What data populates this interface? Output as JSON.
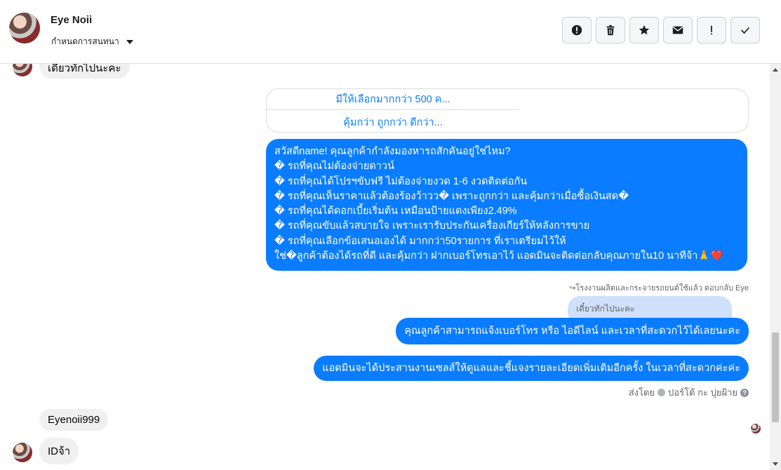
{
  "header": {
    "name": "Eye Noii",
    "assign_label": "กำหนดการสนทนา",
    "actions": [
      "mark-spam",
      "delete",
      "star",
      "mark-unread",
      "follow-up",
      "done"
    ]
  },
  "thread": {
    "prev_msg": "เดี๋ยวทักไปนะคะ",
    "quick_replies": [
      "มีให้เลือกมากกว่า 500 ค...",
      "คุ้มกว่า ถูกกว่า ดีกว่า..."
    ],
    "big_message_lines": [
      "สวัสดีname! คุณลูกค้ากำลังมองหารถสักคันอยู่ใช่ไหม?",
      "� รถที่คุณไม่ต้องจ่ายดาวน์",
      "� รถที่คุณได้โปรฯขับฟรี ไม่ต้องจ่ายงวด 1-6 งวดติดต่อกัน",
      "� รถที่คุณเห็นราคาแล้วต้องร้องว้าวว� เพราะถูกกว่า และคุ้มกว่าเมื่อซื้อเงินสด�",
      "� รถที่คุณได้ดอกเบี้ยเริ่มต้น เหมือนป้ายแดงเพียง2.49%",
      "� รถที่คุณขับแล้วสบายใจ เพราะเรารับประกันเครื่องเกียร์ให้หลังการขาย",
      "� รถที่คุณเลือกข้อเสนอเองได้ มากกว่า50รายการ ที่เราเตรียมไว้ให้",
      "ใช่�ลูกค้าต้องได้รถที่ดี และคุ้มกว่า ฝากเบอร์โทรเอาไว้ แอดมินจะติดต่อกลับคุณภายใน10 นาทีจ้า🙏❤️"
    ],
    "reply_note": "↪โรงงานผลิตและกระจายรถยนต์ใช้แล้ว ตอบกลับ Eye",
    "quoted_msg": "เดี๋ยวทักไปนะคะ",
    "reply_msg_1": "คุณลูกค้าสามารถแจ้งเบอร์โทร หรือ ไอดีไลน์ และเวลาที่สะดวกไว้ได้เลยนะคะ",
    "reply_msg_2": "แอดมินจะได้ประสานงานเซลส์ให้ดูแลและชี้แจงรายละเอียดเพิ่มเติมอีกครั้ง ในเวลาที่สะดวกค่ะค่ะ",
    "sent_by_prefix": "ส่งโดย",
    "sent_by_name": "ปอร์โด้ กะ ปุยฝ้าย",
    "in_msg_1": "Eyenoii999",
    "in_msg_2": "IDจ้า"
  }
}
